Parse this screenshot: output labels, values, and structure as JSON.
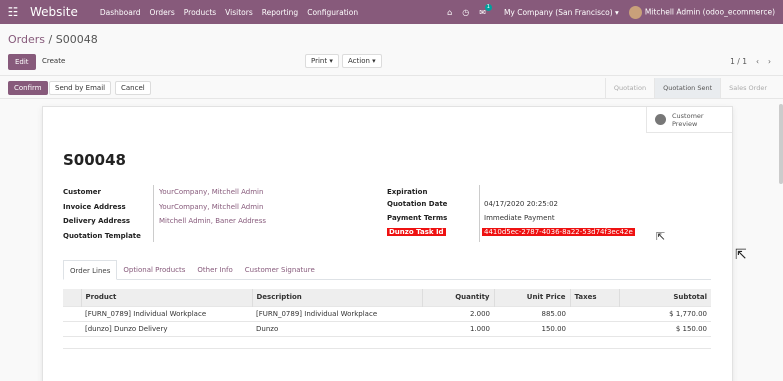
{
  "navbar": {
    "apps_icon": "apps-grid-icon",
    "brand": "Website",
    "menu": [
      "Dashboard",
      "Orders",
      "Products",
      "Visitors",
      "Reporting",
      "Configuration"
    ],
    "chat_badge": "1",
    "company": "My Company (San Francisco) ▾",
    "user": "Mitchell Admin (odoo_ecommerce)",
    "accent_color": "#875a7b"
  },
  "breadcrumb": {
    "parent": "Orders",
    "separator": "/",
    "current": "S00048"
  },
  "toolbar": {
    "edit": "Edit",
    "create": "Create",
    "print": "Print ▾",
    "action": "Action ▾",
    "pager": "1 / 1"
  },
  "statusbar": {
    "confirm": "Confirm",
    "send_email": "Send by Email",
    "cancel": "Cancel",
    "stages": [
      "Quotation",
      "Quotation Sent",
      "Sales Order"
    ]
  },
  "sheet": {
    "customer_preview": [
      "Customer",
      "Preview"
    ],
    "title": "S00048",
    "left_fields": [
      {
        "label": "Customer",
        "value": "YourCompany, Mitchell Admin"
      },
      {
        "label": "Invoice Address",
        "value": "YourCompany, Mitchell Admin"
      },
      {
        "label": "Delivery Address",
        "value": "Mitchell Admin, Baner Address"
      },
      {
        "label": "Quotation Template",
        "value": ""
      }
    ],
    "right_fields": [
      {
        "label": "Expiration",
        "value": ""
      },
      {
        "label": "Quotation Date",
        "value": "04/17/2020 20:25:02"
      },
      {
        "label": "Payment Terms",
        "value": "Immediate Payment"
      },
      {
        "label": "Dunzo Task Id",
        "value": "4410d5ec-2787-4036-8a22-53d74f3ec42e"
      }
    ],
    "tabs": [
      "Order Lines",
      "Optional Products",
      "Other Info",
      "Customer Signature"
    ],
    "table": {
      "headers": [
        "Product",
        "Description",
        "Quantity",
        "Unit Price",
        "Taxes",
        "Subtotal"
      ],
      "rows": [
        [
          "[FURN_0789] Individual Workplace",
          "[FURN_0789] Individual Workplace",
          "2.000",
          "885.00",
          "",
          "$ 1,770.00"
        ],
        [
          "[dunzo] Dunzo Delivery",
          "Dunzo",
          "1.000",
          "150.00",
          "",
          "$ 150.00"
        ]
      ]
    }
  }
}
